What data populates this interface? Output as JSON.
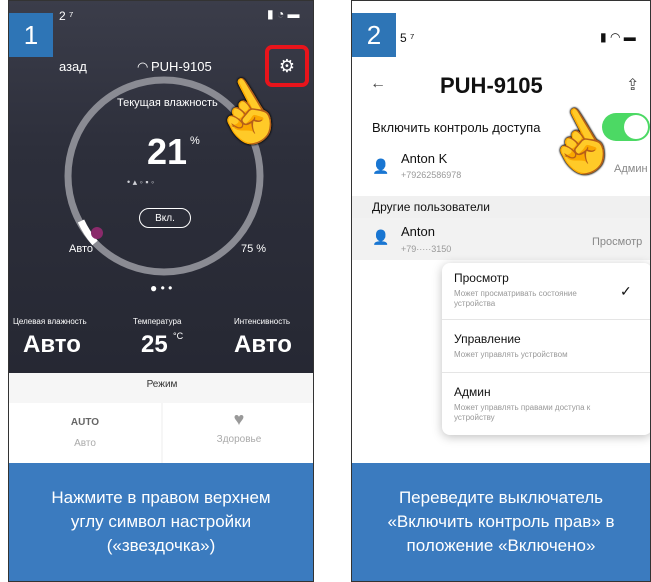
{
  "panel1": {
    "step": "1",
    "status_time": "2 ⁷",
    "back_label": "азад",
    "device_name": "PUH-9105",
    "current_humidity_label": "Текущая влажность",
    "humidity_value": "21",
    "humidity_unit": "%",
    "power_button_label": "Вкл.",
    "ring_left_label": "Авто",
    "ring_right_label": "75 %",
    "metrics": [
      {
        "label": "Целевая влажность",
        "value": "Авто"
      },
      {
        "label": "Температура",
        "value": "25",
        "unit": "°C"
      },
      {
        "label": "Интенсивность",
        "value": "Авто"
      }
    ],
    "mode_header": "Режим",
    "modes": [
      {
        "title": "AUTO",
        "label": "Авто"
      },
      {
        "title": "",
        "label": "Здоровье"
      }
    ],
    "caption": "Нажмите в правом верхнем углу символ настройки («звездочка»)"
  },
  "panel2": {
    "step": "2",
    "status_time": "5 ⁷",
    "title": "PUH-9105",
    "access_toggle_label": "Включить контроль доступа",
    "owner": {
      "name": "Anton K",
      "phone": "+79262586978",
      "role": "Админ"
    },
    "others_header": "Другие пользователи",
    "other_user": {
      "name": "Anton",
      "phone": "+79·····3150",
      "role": "Просмотр"
    },
    "menu": [
      {
        "title": "Просмотр",
        "desc": "Может просматривать состояние устройства",
        "checked": true
      },
      {
        "title": "Управление",
        "desc": "Может управлять устройством",
        "checked": false
      },
      {
        "title": "Админ",
        "desc": "Может управлять правами доступа к устройству",
        "checked": false
      }
    ],
    "caption": "Переведите выключатель «Включить контроль прав» в положение «Включено»"
  },
  "colors": {
    "badge": "#2E75B6",
    "caption_bg": "#3B7BBF",
    "toggle_on": "#4CD964",
    "highlight": "#E8141B",
    "ring_dot": "#8B2A6B"
  }
}
